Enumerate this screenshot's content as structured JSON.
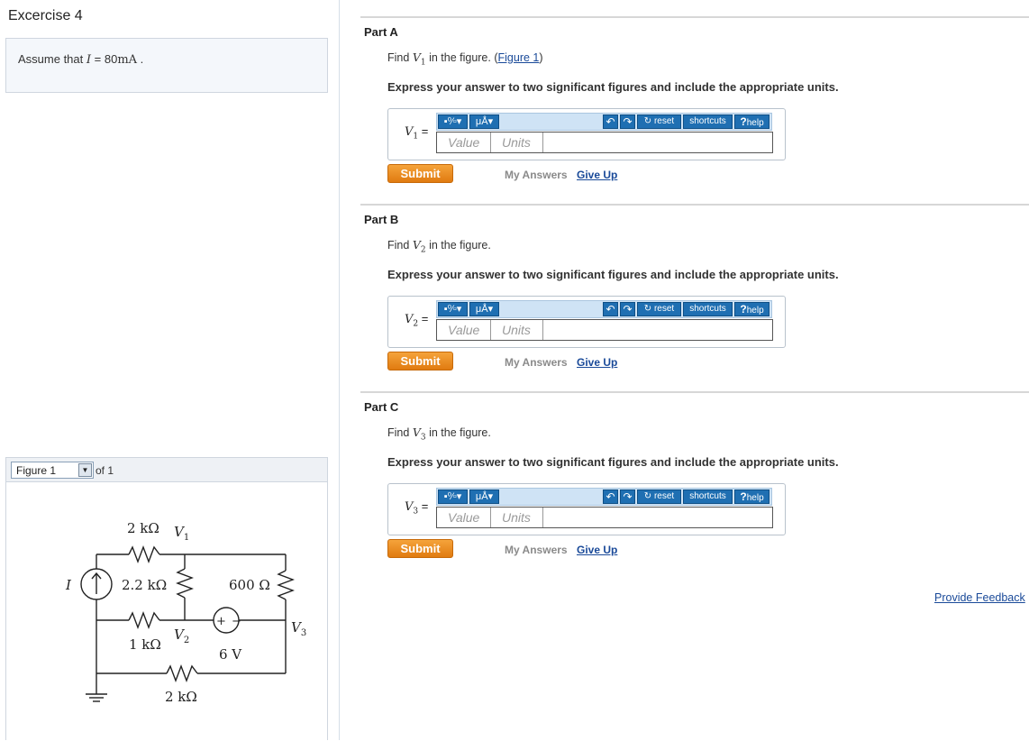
{
  "exercise": {
    "title": "Excercise 4",
    "assume_prefix": "Assume that",
    "assume_var": "I",
    "assume_eq": "= 80",
    "assume_unit": "mA",
    "assume_suffix": "."
  },
  "figure": {
    "select_value": "Figure 1",
    "of_text": "of 1",
    "labels": {
      "r_top": "2 kΩ",
      "v1": "V",
      "v1_sub": "1",
      "i": "I",
      "r_2_2k": "2.2 kΩ",
      "r_600": "600 Ω",
      "r_1k": "1 kΩ",
      "v2": "V",
      "v2_sub": "2",
      "v3": "V",
      "v3_sub": "3",
      "src_6v": "6 V",
      "r_bottom": "2 kΩ",
      "plus": "+",
      "minus": "−"
    }
  },
  "parts": [
    {
      "title": "Part A",
      "find_prefix": "Find",
      "var": "V",
      "sub": "1",
      "find_suffix": "in the figure.",
      "figure_link": "Figure 1",
      "express": "Express your answer to two significant figures and include the appropriate units.",
      "label_eq": "=",
      "value_placeholder": "Value",
      "units_placeholder": "Units",
      "submit": "Submit",
      "my_answers": "My Answers",
      "give_up": "Give Up"
    },
    {
      "title": "Part B",
      "find_prefix": "Find",
      "var": "V",
      "sub": "2",
      "find_suffix": "in the figure.",
      "express": "Express your answer to two significant figures and include the appropriate units.",
      "label_eq": "=",
      "value_placeholder": "Value",
      "units_placeholder": "Units",
      "submit": "Submit",
      "my_answers": "My Answers",
      "give_up": "Give Up"
    },
    {
      "title": "Part C",
      "find_prefix": "Find",
      "var": "V",
      "sub": "3",
      "find_suffix": "in the figure.",
      "express": "Express your answer to two significant figures and include the appropriate units.",
      "label_eq": "=",
      "value_placeholder": "Value",
      "units_placeholder": "Units",
      "submit": "Submit",
      "my_answers": "My Answers",
      "give_up": "Give Up"
    }
  ],
  "toolbar": {
    "templates_icon": "template-icon",
    "units_symbol": "μÅ",
    "undo_icon": "undo-icon",
    "redo_icon": "redo-icon",
    "reset": "reset",
    "shortcuts": "shortcuts",
    "help_mark": "?",
    "help": "help"
  },
  "feedback_link": "Provide Feedback",
  "colors": {
    "accent": "#1f6fb2",
    "submit": "#f08d1e",
    "link": "#1a4a99"
  }
}
